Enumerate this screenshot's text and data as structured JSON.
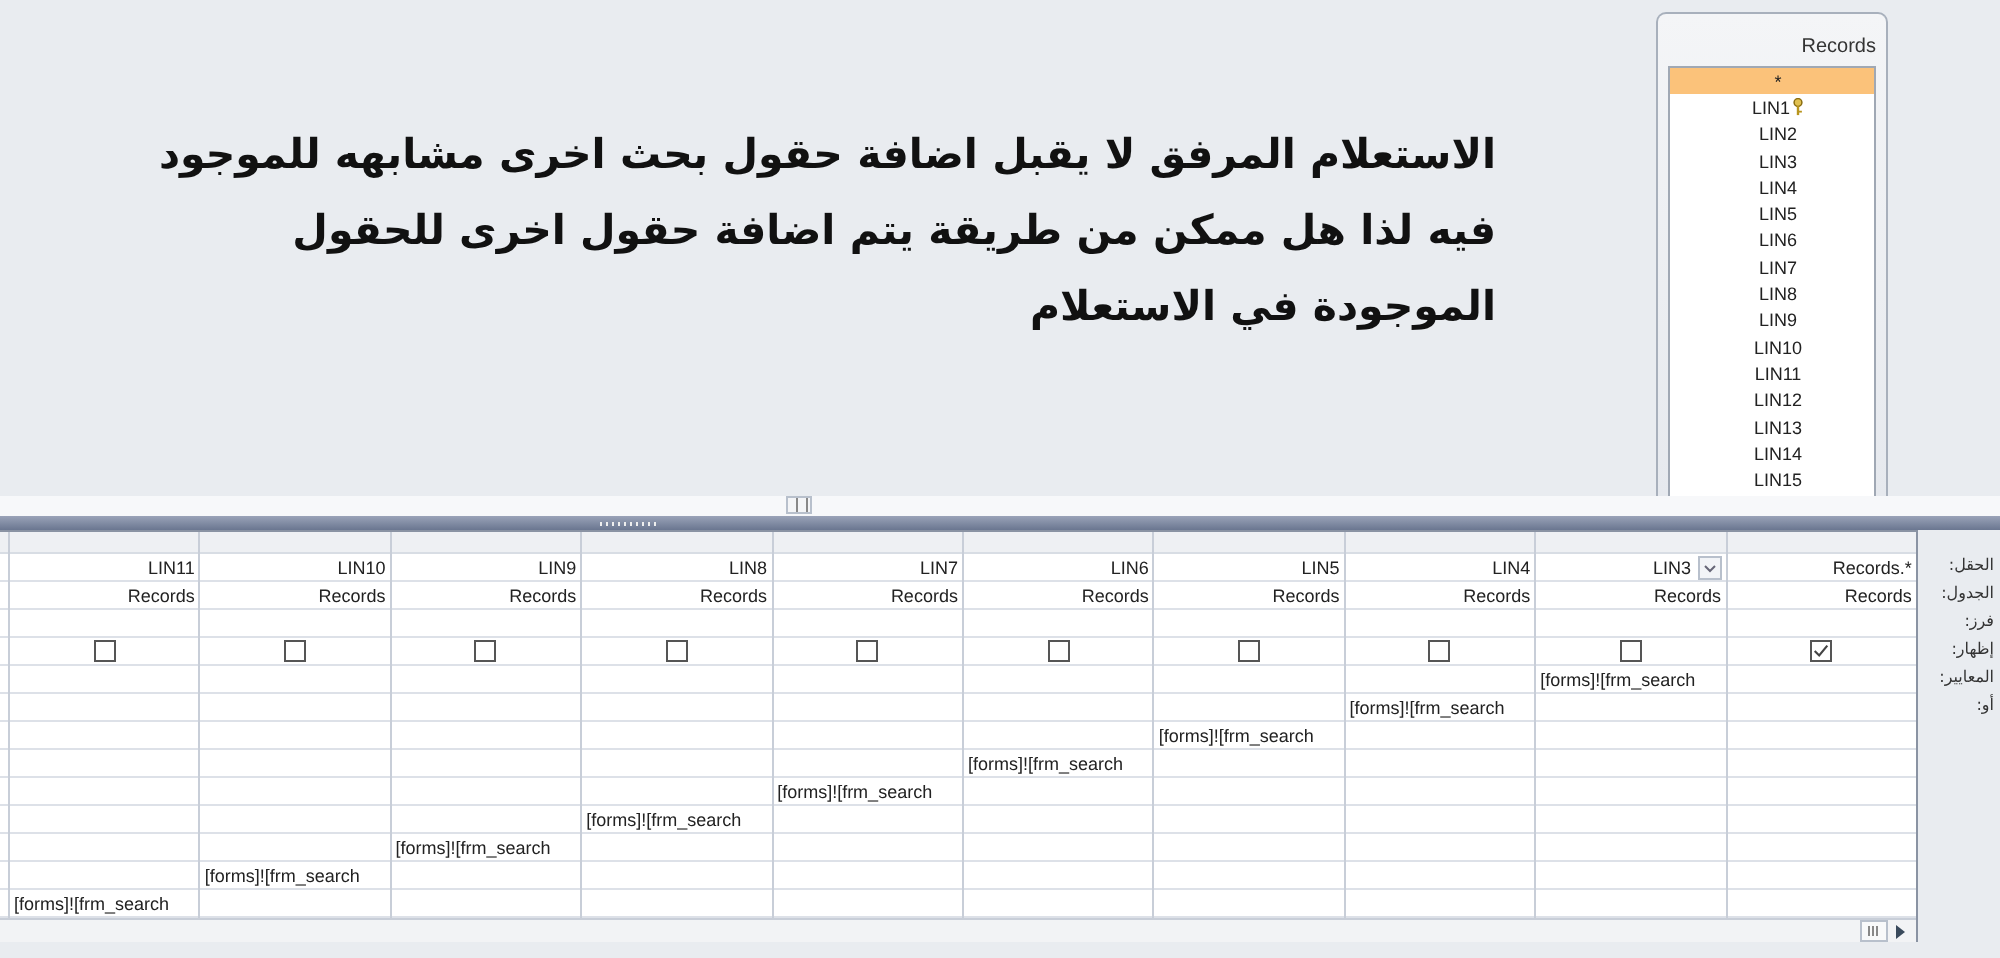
{
  "question": "الاستعلام المرفق لا يقبل اضافة حقول بحث اخرى مشابهه للموجود فيه لذا هل ممكن من طريقة يتم اضافة حقول اخرى للحقول الموجودة في الاستعلام",
  "table": {
    "title": "Records",
    "fields": [
      {
        "name": "*",
        "selected": true,
        "key": false
      },
      {
        "name": "LIN1",
        "selected": false,
        "key": true
      },
      {
        "name": "LIN2",
        "selected": false,
        "key": false
      },
      {
        "name": "LIN3",
        "selected": false,
        "key": false
      },
      {
        "name": "LIN4",
        "selected": false,
        "key": false
      },
      {
        "name": "LIN5",
        "selected": false,
        "key": false
      },
      {
        "name": "LIN6",
        "selected": false,
        "key": false
      },
      {
        "name": "LIN7",
        "selected": false,
        "key": false
      },
      {
        "name": "LIN8",
        "selected": false,
        "key": false
      },
      {
        "name": "LIN9",
        "selected": false,
        "key": false
      },
      {
        "name": "LIN10",
        "selected": false,
        "key": false
      },
      {
        "name": "LIN11",
        "selected": false,
        "key": false
      },
      {
        "name": "LIN12",
        "selected": false,
        "key": false
      },
      {
        "name": "LIN13",
        "selected": false,
        "key": false
      },
      {
        "name": "LIN14",
        "selected": false,
        "key": false
      },
      {
        "name": "LIN15",
        "selected": false,
        "key": false
      }
    ]
  },
  "row_labels": [
    "الحقل:",
    "الجدول:",
    "فرز:",
    "إظهار:",
    "المعايير:",
    "أو:"
  ],
  "columns": [
    {
      "field": "LIN11",
      "table": "Records",
      "show": false,
      "active": false,
      "criteria": "[forms]![frm_search"
    },
    {
      "field": "LIN10",
      "table": "Records",
      "show": false,
      "active": false,
      "criteria": "[forms]![frm_search"
    },
    {
      "field": "LIN9",
      "table": "Records",
      "show": false,
      "active": false,
      "criteria": "[forms]![frm_search"
    },
    {
      "field": "LIN8",
      "table": "Records",
      "show": false,
      "active": false,
      "criteria": "[forms]![frm_search"
    },
    {
      "field": "LIN7",
      "table": "Records",
      "show": false,
      "active": false,
      "criteria": "[forms]![frm_search"
    },
    {
      "field": "LIN6",
      "table": "Records",
      "show": false,
      "active": false,
      "criteria": "[forms]![frm_search"
    },
    {
      "field": "LIN5",
      "table": "Records",
      "show": false,
      "active": false,
      "criteria": "[forms]![frm_search"
    },
    {
      "field": "LIN4",
      "table": "Records",
      "show": false,
      "active": false,
      "criteria": "[forms]![frm_search"
    },
    {
      "field": "LIN3",
      "table": "Records",
      "show": false,
      "active": true,
      "criteria": "[forms]![frm_search"
    },
    {
      "field": "Records.*",
      "table": "Records",
      "show": true,
      "active": false
    }
  ]
}
